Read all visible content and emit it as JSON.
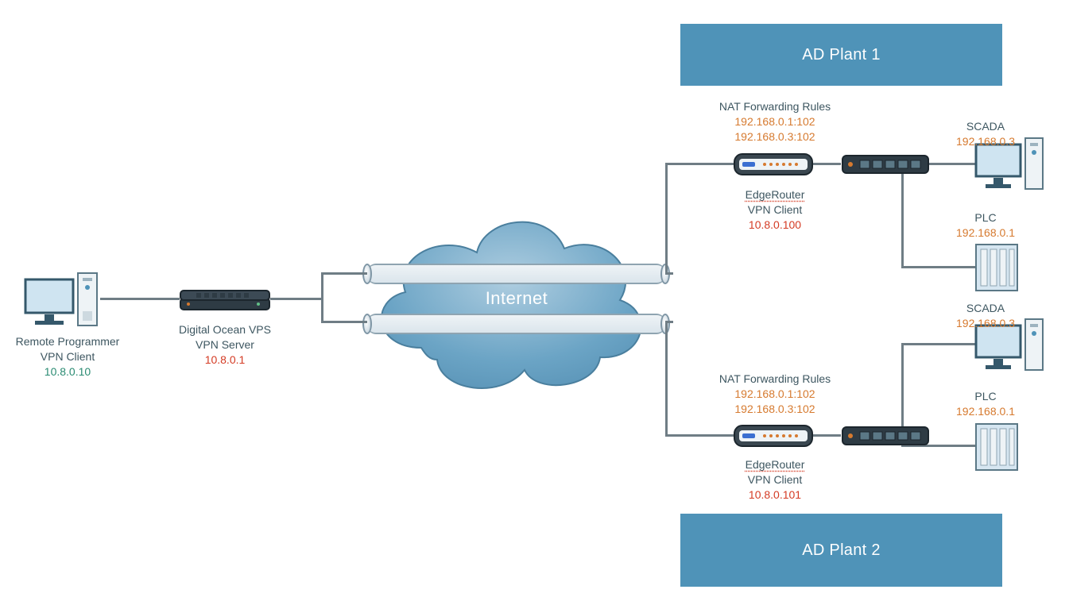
{
  "colors": {
    "banner": "#4f93b8",
    "text": "#3d5660",
    "ip_red": "#d43b24",
    "ip_green": "#2a8b72",
    "ip_orange": "#d67a2f",
    "wire": "#6f7d85"
  },
  "banners": {
    "plant1": "AD Plant 1",
    "plant2": "AD Plant 2"
  },
  "cloud": {
    "label": "Internet"
  },
  "programmer": {
    "line1": "Remote Programmer",
    "line2": "VPN Client",
    "ip": "10.8.0.10"
  },
  "vps": {
    "line1": "Digital Ocean VPS",
    "line2": "VPN Server",
    "ip": "10.8.0.1"
  },
  "edge1": {
    "nat_title": "NAT Forwarding Rules",
    "nat_rule1": "192.168.0.1:102",
    "nat_rule2": "192.168.0.3:102",
    "line1": "EdgeRouter",
    "line2": "VPN Client",
    "ip": "10.8.0.100"
  },
  "edge2": {
    "nat_title": "NAT Forwarding Rules",
    "nat_rule1": "192.168.0.1:102",
    "nat_rule2": "192.168.0.3:102",
    "line1": "EdgeRouter",
    "line2": "VPN Client",
    "ip": "10.8.0.101"
  },
  "plant1": {
    "scada_label": "SCADA",
    "scada_ip": "192.168.0.3",
    "plc_label": "PLC",
    "plc_ip": "192.168.0.1"
  },
  "plant2": {
    "scada_label": "SCADA",
    "scada_ip": "192.168.0.3",
    "plc_label": "PLC",
    "plc_ip": "192.168.0.1"
  }
}
